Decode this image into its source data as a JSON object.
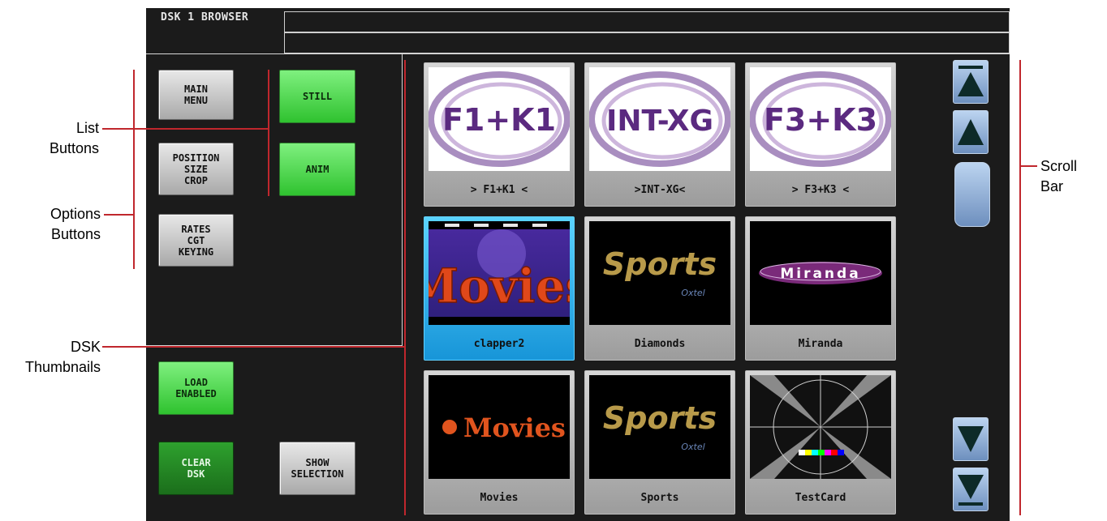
{
  "window": {
    "title": "DSK 1 BROWSER"
  },
  "options_buttons": [
    {
      "label": "MAIN\nMENU"
    },
    {
      "label": "POSITION\nSIZE\nCROP"
    },
    {
      "label": "RATES\nCGT\nKEYING"
    }
  ],
  "list_buttons": [
    {
      "label": "STILL"
    },
    {
      "label": "ANIM"
    }
  ],
  "bottom_buttons": {
    "load": "LOAD\nENABLED",
    "clear": "CLEAR\nDSK",
    "show": "SHOW\nSELECTION"
  },
  "thumbnails": [
    {
      "label": "> F1+K1 <",
      "art_text": "F1+K1",
      "selected": false
    },
    {
      "label": ">INT-XG<",
      "art_text": "INT-XG",
      "selected": false
    },
    {
      "label": "> F3+K3 <",
      "art_text": "F3+K3",
      "selected": false
    },
    {
      "label": "clapper2",
      "art_text": "Movies",
      "selected": true
    },
    {
      "label": "Diamonds",
      "art_text": "Sports",
      "art_sub": "Oxtel",
      "selected": false
    },
    {
      "label": "Miranda",
      "art_text": "Miranda",
      "selected": false
    },
    {
      "label": "Movies",
      "art_text": "Movies",
      "selected": false
    },
    {
      "label": "Sports",
      "art_text": "Sports",
      "art_sub": "Oxtel",
      "selected": false
    },
    {
      "label": "TestCard",
      "selected": false
    }
  ],
  "scroll_bar": {
    "buttons": [
      "scroll-top-icon",
      "scroll-up-icon",
      "scroll-down-icon",
      "scroll-bottom-icon"
    ]
  },
  "callouts": {
    "list_buttons": "List\nButtons",
    "options_buttons": "Options\nButtons",
    "dsk_thumbnails": "DSK\nThumbnails",
    "scroll_bar": "Scroll\nBar"
  },
  "colors": {
    "accent_red": "#c0272d",
    "green_button": "#3fd23f",
    "selection_blue": "#1fa8ee"
  }
}
